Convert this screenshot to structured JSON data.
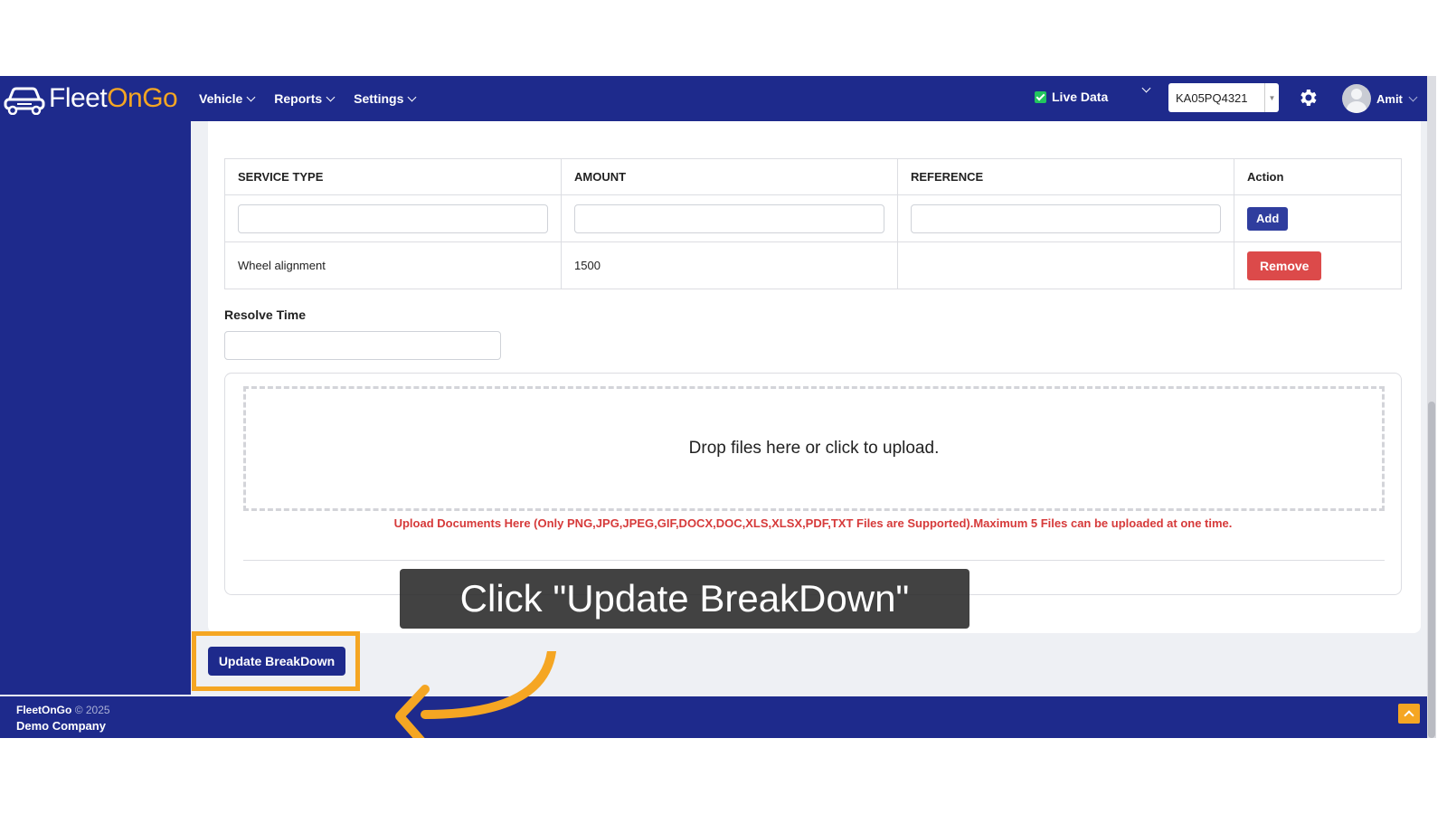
{
  "header": {
    "logo_part1": "Fleet",
    "logo_part2": "OnGo",
    "nav": [
      {
        "label": "Vehicle"
      },
      {
        "label": "Reports"
      },
      {
        "label": "Settings"
      }
    ],
    "live_data_label": "Live Data",
    "vehicle_select_value": "KA05PQ4321",
    "user_name": "Amit"
  },
  "table": {
    "columns": [
      "SERVICE TYPE",
      "AMOUNT",
      "REFERENCE",
      "Action"
    ],
    "add_label": "Add",
    "rows": [
      {
        "service_type": "Wheel alignment",
        "amount": "1500",
        "reference": "",
        "action_label": "Remove"
      }
    ]
  },
  "resolve_time": {
    "label": "Resolve Time",
    "value": ""
  },
  "upload": {
    "drop_text": "Drop files here or click to upload.",
    "note": "Upload Documents Here (Only PNG,JPG,JPEG,GIF,DOCX,DOC,XLS,XLSX,PDF,TXT Files are Supported).Maximum 5 Files can be uploaded at one time."
  },
  "update_button_label": "Update BreakDown",
  "tooltip_text": "Click \"Update BreakDown\"",
  "footer": {
    "brand": "FleetOnGo",
    "copyright": "© 2025",
    "company": "Demo Company"
  },
  "colors": {
    "primary": "#1e2a8c",
    "accent": "#f5a623",
    "danger": "#dc4a4a",
    "success": "#22c55e"
  }
}
